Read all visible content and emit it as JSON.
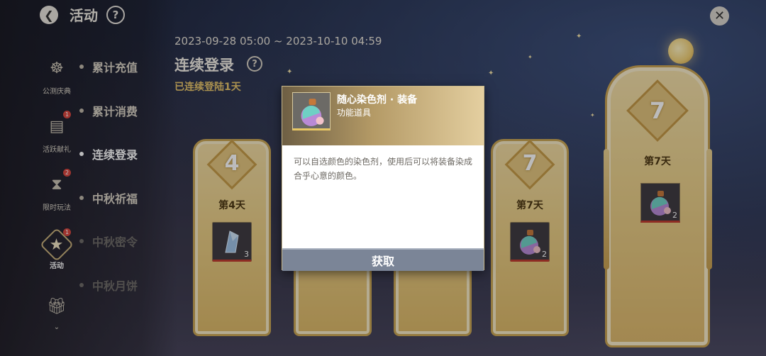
{
  "header": {
    "back_icon": "back-arrow-icon",
    "title": "活动",
    "help_label": "?",
    "close_label": "✕"
  },
  "categories": [
    {
      "label": "公测庆典",
      "icon": "festival-icon",
      "badge": ""
    },
    {
      "label": "活跃献礼",
      "icon": "gift-book-icon",
      "badge": "1"
    },
    {
      "label": "限时玩法",
      "icon": "hourglass-icon",
      "badge": "2"
    },
    {
      "label": "活动",
      "icon": "star-badge-icon",
      "badge": "1",
      "active": true
    },
    {
      "label": "",
      "icon": "gift-box-icon",
      "badge": ""
    }
  ],
  "submenu": [
    {
      "label": "累计充值"
    },
    {
      "label": "累计消费"
    },
    {
      "label": "连续登录",
      "active": true
    },
    {
      "label": "中秋祈福"
    },
    {
      "label": "中秋密令"
    },
    {
      "label": "中秋月饼"
    }
  ],
  "event": {
    "date_range": "2023-09-28 05:00 ~ 2023-10-10 04:59",
    "title": "连续登录",
    "help_label": "?",
    "streak_text": "已连续登陆1天"
  },
  "rewards": [
    {
      "num": "4",
      "day": "第4天",
      "item_count": "3",
      "item": "crystal-shard-icon"
    },
    {
      "num": "7",
      "day": "第7天",
      "item_count": "2",
      "item": "dye-potion-icon"
    },
    {
      "num": "7",
      "day": "第7天",
      "item_count": "2",
      "item": "dye-potion-icon",
      "featured": true
    }
  ],
  "popup": {
    "item_name": "随心染色剂 · 装备",
    "item_type": "功能道具",
    "description": "可以自选颜色的染色剂，使用后可以将装备染成合乎心意的颜色。",
    "action_label": "获取",
    "item_icon": "dye-potion-icon"
  }
}
